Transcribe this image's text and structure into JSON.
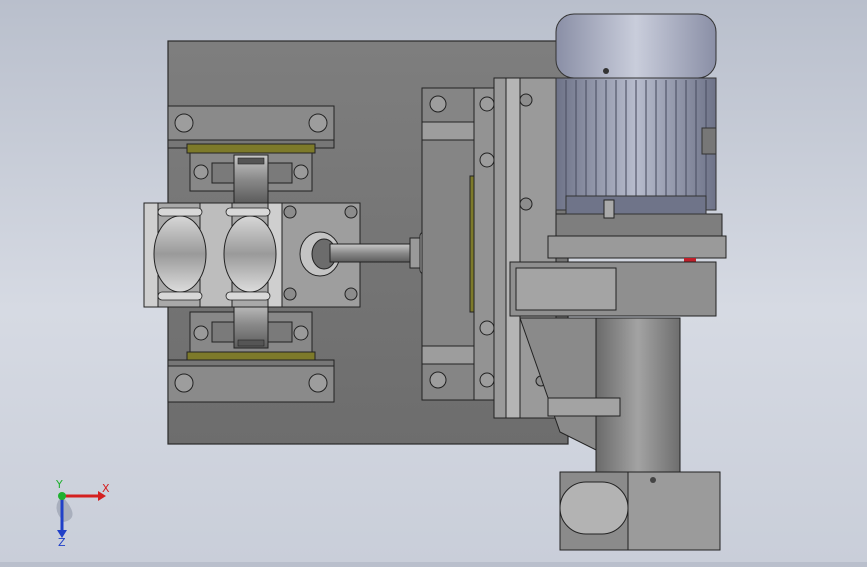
{
  "viewport": {
    "background_top": "#b9bfcc",
    "background_bottom": "#d6dae3",
    "steel_color": "#8e8e8e",
    "motor_color": "#9aa0b8",
    "highlight_color": "#7d7a2a",
    "accent_red": "#c0202a"
  },
  "triad": {
    "x_label": "X",
    "y_label": "Y",
    "z_label": "Z",
    "x_color": "#d42020",
    "y_color": "#20b030",
    "z_color": "#2040c8"
  }
}
